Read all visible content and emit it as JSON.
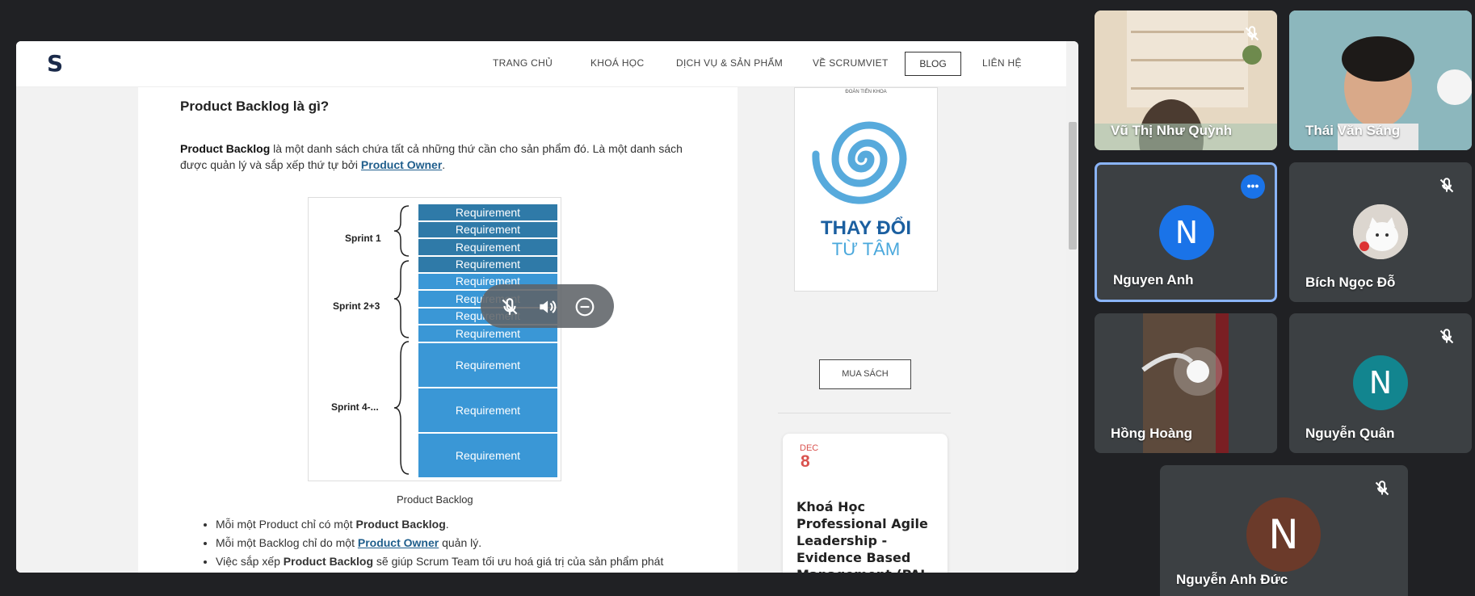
{
  "site": {
    "logo": "S",
    "nav": [
      "TRANG CHỦ",
      "KHOÁ HỌC",
      "DỊCH VỤ & SẢN PHẨM",
      "VỀ SCRUMVIET",
      "BLOG",
      "LIÊN HỆ"
    ]
  },
  "article": {
    "heading": "Product Backlog là gì?",
    "para_bold": "Product Backlog",
    "para_text1": " là một danh sách chứa tất cả những thứ cần cho sản phẩm đó. Là một danh sách được quản lý và sắp xếp thứ tự bởi ",
    "para_link": "Product Owner",
    "para_end": ".",
    "figure": {
      "sprints": [
        "Sprint 1",
        "Sprint 2+3",
        "Sprint 4-..."
      ],
      "requirement_label": "Requirement",
      "caption": "Product Backlog"
    },
    "bullets": [
      {
        "pre": "Mỗi một Product chỉ có một ",
        "bold": "Product Backlog",
        "post": "."
      },
      {
        "pre": "Mỗi một Backlog chỉ do một ",
        "link": "Product Owner",
        "post": " quản lý."
      },
      {
        "pre": "Việc sắp xếp ",
        "bold": "Product Backlog",
        "post": " sẽ giúp Scrum Team tối ưu hoá giá trị của sản phẩm phát"
      }
    ]
  },
  "sidebar": {
    "book_subtitle": "ĐOÀN TIẾN KHOA",
    "book_title_line1": "THAY ĐỔI",
    "book_title_line2": "TỪ TÂM",
    "buy_button": "MUA SÁCH",
    "event": {
      "month": "DEC",
      "day": "8",
      "title": "Khoá Học Professional Agile Leadership - Evidence Based Management (PAL-EBM)"
    }
  },
  "participants": [
    {
      "name": "Vũ Thị Như Quỳnh",
      "muted": true
    },
    {
      "name": "Thái Văn Sáng",
      "muted": false
    },
    {
      "name": "Nguyen Anh",
      "initial": "N",
      "avatar_color": "#1a73e8",
      "speaking": true
    },
    {
      "name": "Bích Ngọc Đỗ",
      "muted": true
    },
    {
      "name": "Hồng Hoàng",
      "muted": false
    },
    {
      "name": "Nguyễn Quân",
      "initial": "N",
      "avatar_color": "#12858f",
      "muted": true
    },
    {
      "name": "Nguyễn Anh Đức",
      "initial": "N",
      "avatar_color": "#6b3a2a",
      "muted": true
    }
  ],
  "colors": {
    "meet_bg": "#202124",
    "tile_bg": "#3c4043",
    "accent": "#1a73e8",
    "req_dark": "#2f7aa8",
    "req_light": "#3a97d6"
  },
  "icons": [
    "mic-off-icon",
    "volume-icon",
    "remove-icon",
    "more-options-icon"
  ]
}
